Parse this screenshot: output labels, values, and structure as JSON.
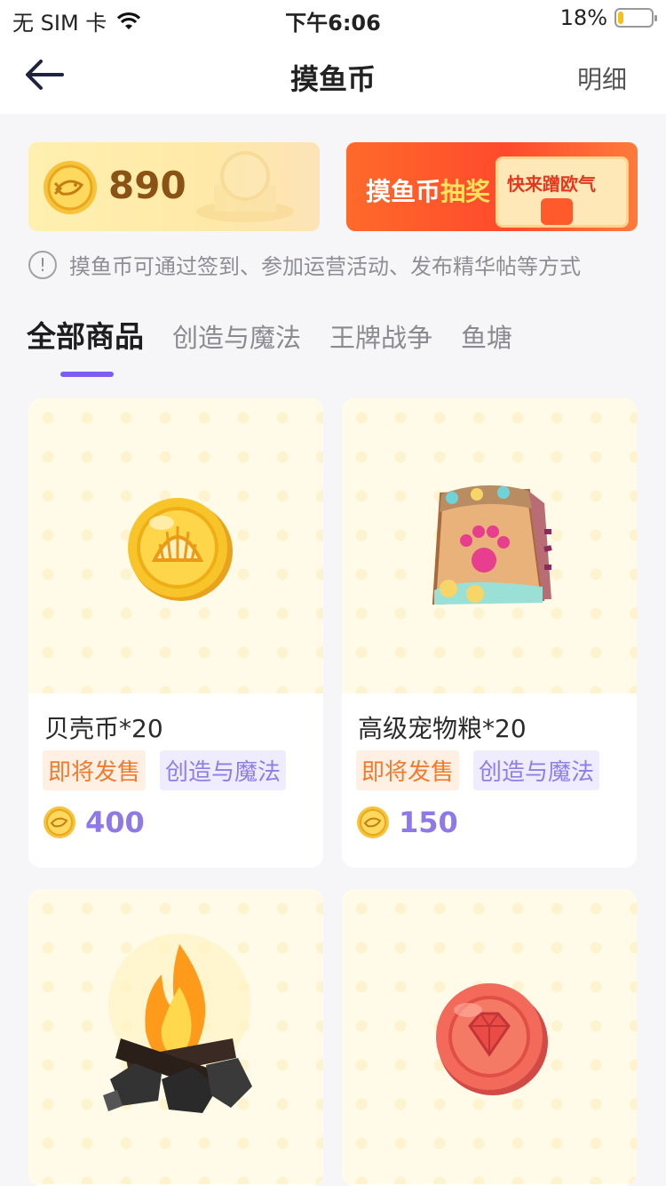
{
  "status_bar": {
    "carrier": "无 SIM 卡",
    "time": "下午6:06",
    "battery": "18%",
    "battery_level": 0.18
  },
  "nav": {
    "title": "摸鱼币",
    "right_label": "明细"
  },
  "coin_card": {
    "count": "890"
  },
  "lottery": {
    "title_part1": "摸鱼币",
    "title_part2": "抽奖",
    "button": "快来蹭欧气"
  },
  "info_text": "摸鱼币可通过签到、参加运营活动、发布精华帖等方式",
  "tabs": [
    {
      "label": "全部商品",
      "active": true
    },
    {
      "label": "创造与魔法"
    },
    {
      "label": "王牌战争"
    },
    {
      "label": "鱼塘"
    }
  ],
  "products": [
    {
      "name": "贝壳币*20",
      "tags": [
        "即将发售",
        "创造与魔法"
      ],
      "price": "400",
      "icon": "shell-coin-icon"
    },
    {
      "name": "高级宠物粮*20",
      "tags": [
        "即将发售",
        "创造与魔法"
      ],
      "price": "150",
      "icon": "pet-food-bag-icon"
    },
    {
      "name": "",
      "tags": [],
      "price": "",
      "icon": "campfire-icon"
    },
    {
      "name": "",
      "tags": [],
      "price": "",
      "icon": "red-gem-coin-icon"
    }
  ],
  "colors": {
    "accent": "#7d5cf0",
    "price": "#8f79e6",
    "tag_orange": "#f07a2e",
    "tag_purple": "#8f7ee6"
  }
}
